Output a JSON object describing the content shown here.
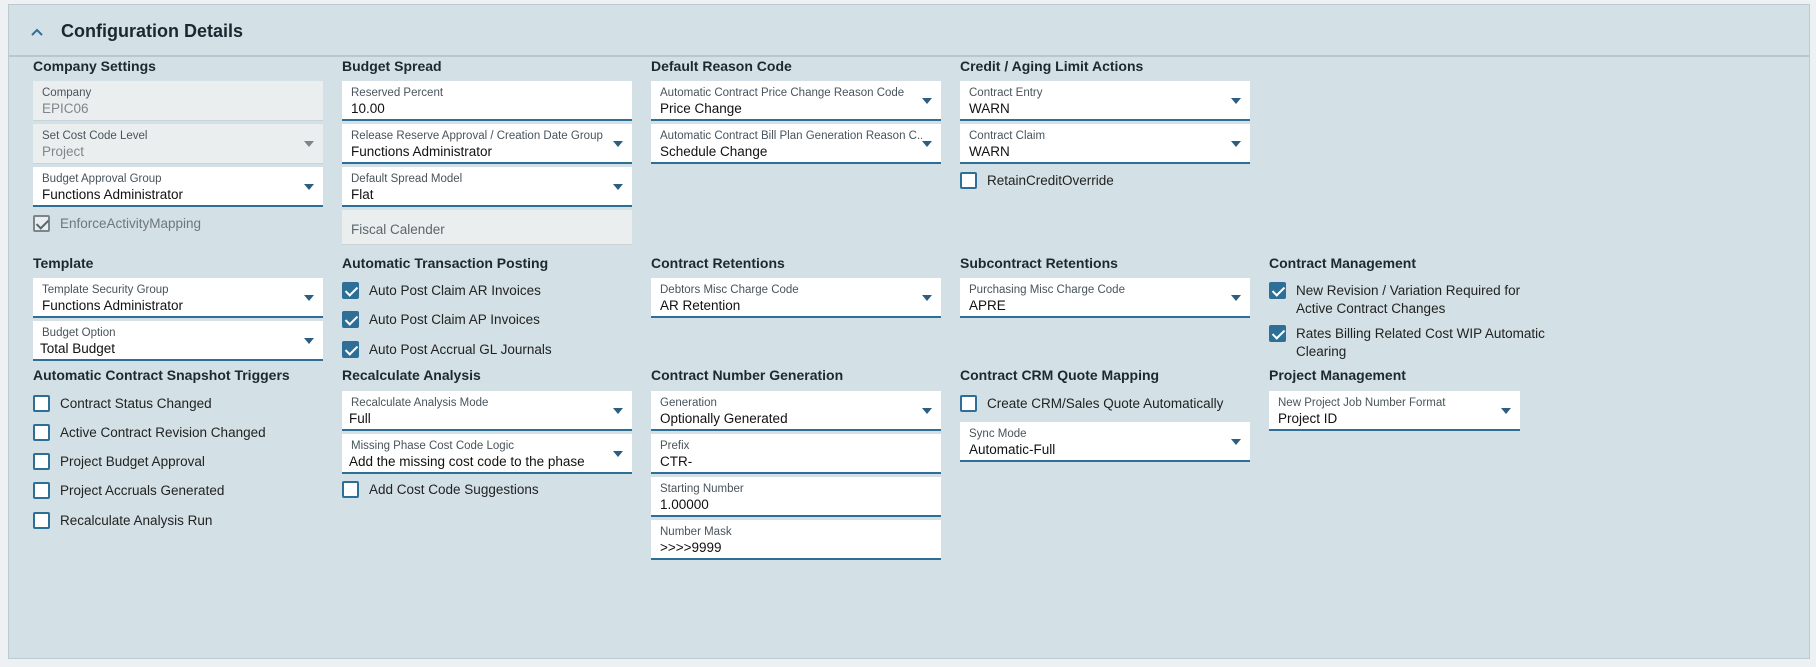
{
  "panel": {
    "title": "Configuration Details"
  },
  "company_settings": {
    "title": "Company Settings",
    "company": {
      "label": "Company",
      "value": "EPIC06"
    },
    "cost_code_level": {
      "label": "Set Cost Code Level",
      "value": "Project"
    },
    "budget_approval_group": {
      "label": "Budget Approval Group",
      "value": "Functions Administrator"
    },
    "enforce_activity_mapping": {
      "label": "EnforceActivityMapping",
      "checked": true
    }
  },
  "budget_spread": {
    "title": "Budget Spread",
    "reserved_percent": {
      "label": "Reserved Percent",
      "value": "10.00"
    },
    "release_reserve_group": {
      "label": "Release Reserve Approval / Creation Date Group",
      "value": "Functions Administrator"
    },
    "default_spread_model": {
      "label": "Default Spread Model",
      "value": "Flat"
    },
    "fiscal_calender": {
      "placeholder": "Fiscal Calender"
    }
  },
  "default_reason_code": {
    "title": "Default Reason Code",
    "price_change": {
      "label": "Automatic Contract Price Change Reason Code",
      "value": "Price Change"
    },
    "bill_plan": {
      "label": "Automatic Contract Bill Plan Generation Reason C...",
      "value": "Schedule Change"
    }
  },
  "credit_aging": {
    "title": "Credit / Aging Limit Actions",
    "contract_entry": {
      "label": "Contract Entry",
      "value": "WARN"
    },
    "contract_claim": {
      "label": "Contract Claim",
      "value": "WARN"
    },
    "retain_credit_override": {
      "label": "RetainCreditOverride",
      "checked": false
    }
  },
  "template": {
    "title": "Template",
    "security_group": {
      "label": "Template Security Group",
      "value": "Functions Administrator"
    },
    "budget_option": {
      "label": "Budget Option",
      "value": "Total Budget"
    }
  },
  "auto_posting": {
    "title": "Automatic Transaction Posting",
    "items": [
      {
        "label": "Auto Post Claim AR Invoices",
        "checked": true
      },
      {
        "label": "Auto Post Claim AP Invoices",
        "checked": true
      },
      {
        "label": "Auto Post Accrual GL Journals",
        "checked": true
      }
    ]
  },
  "contract_retentions": {
    "title": "Contract Retentions",
    "debtors_misc": {
      "label": "Debtors Misc Charge Code",
      "value": "AR Retention"
    }
  },
  "subcontract_retentions": {
    "title": "Subcontract Retentions",
    "purchasing_misc": {
      "label": "Purchasing Misc Charge Code",
      "value": "APRE"
    }
  },
  "contract_management": {
    "title": "Contract Management",
    "items": [
      {
        "label": "New Revision / Variation Required for Active Contract Changes",
        "checked": true
      },
      {
        "label": "Rates Billing Related Cost WIP Automatic Clearing",
        "checked": true
      }
    ]
  },
  "snapshot_triggers": {
    "title": "Automatic Contract Snapshot Triggers",
    "items": [
      {
        "label": "Contract Status Changed",
        "checked": false
      },
      {
        "label": "Active Contract Revision Changed",
        "checked": false
      },
      {
        "label": "Project Budget Approval",
        "checked": false
      },
      {
        "label": "Project Accruals Generated",
        "checked": false
      },
      {
        "label": "Recalculate Analysis Run",
        "checked": false
      }
    ]
  },
  "recalc_analysis": {
    "title": "Recalculate Analysis",
    "mode": {
      "label": "Recalculate Analysis Mode",
      "value": "Full"
    },
    "missing_phase": {
      "label": "Missing Phase Cost Code Logic",
      "value": "Add the missing cost code to the phase"
    },
    "add_suggestions": {
      "label": "Add Cost Code Suggestions",
      "checked": false
    }
  },
  "contract_number": {
    "title": "Contract Number Generation",
    "generation": {
      "label": "Generation",
      "value": "Optionally Generated"
    },
    "prefix": {
      "label": "Prefix",
      "value": "CTR-"
    },
    "starting_number": {
      "label": "Starting Number",
      "value": "1.00000"
    },
    "number_mask": {
      "label": "Number Mask",
      "value": ">>>>9999"
    }
  },
  "crm_quote": {
    "title": "Contract CRM Quote Mapping",
    "create_quote": {
      "label": "Create CRM/Sales Quote Automatically",
      "checked": false
    },
    "sync_mode": {
      "label": "Sync Mode",
      "value": "Automatic-Full"
    }
  },
  "project_management": {
    "title": "Project Management",
    "job_number_format": {
      "label": "New Project Job Number Format",
      "value": "Project ID"
    }
  }
}
